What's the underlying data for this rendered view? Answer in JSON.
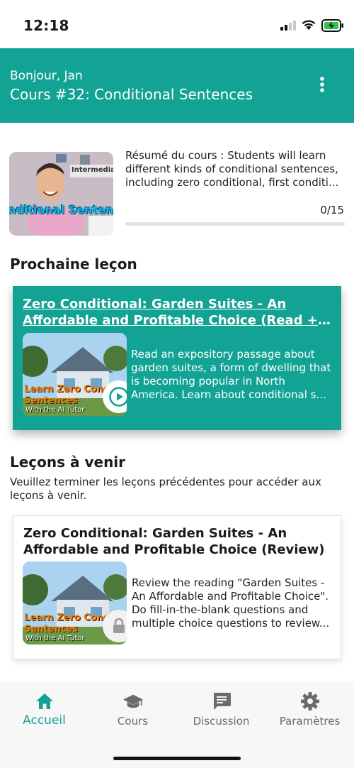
{
  "status_bar": {
    "time": "12:18"
  },
  "header": {
    "greeting": "Bonjour, Jan",
    "course_title": "Cours #32: Conditional Sentences"
  },
  "course": {
    "summary": "Résumé du cours : Students will learn different kinds of conditional sentences, including zero conditional, first conditi...",
    "progress_label": "0/15",
    "progress_value": 0,
    "thumbnail_text_top": "Intermediate C",
    "thumbnail_text_bottom": "nditional Sentenc"
  },
  "next_lesson": {
    "heading": "Prochaine leçon",
    "title_line1": "Zero Conditional: Garden Suites - An",
    "title_line2": "Affordable and Profitable Choice (Read + Sp...",
    "description": "Read an expository passage about garden suites, a form of dwelling that is becoming popular in North America. Learn about conditional s...",
    "thumb_line1": "Learn Zero Condi",
    "thumb_line2": "Sentences",
    "thumb_sub": "With the AI Tutor"
  },
  "upcoming": {
    "heading": "Leçons à venir",
    "note": "Veuillez terminer les leçons précédentes pour accéder aux leçons à venir.",
    "items": [
      {
        "title": "Zero Conditional: Garden Suites - An Affordable and Profitable Choice (Review)",
        "description": "Review the reading \"Garden Suites - An Affordable and Profitable Choice\". Do fill-in-the-blank questions and multiple choice questions to review...",
        "thumb_line1": "Learn Zero Condi",
        "thumb_line2": "Sentences",
        "thumb_sub": "With the AI Tutor"
      }
    ]
  },
  "bottom_nav": [
    {
      "label": "Accueil",
      "icon": "home-icon",
      "active": true
    },
    {
      "label": "Cours",
      "icon": "graduation-cap-icon",
      "active": false
    },
    {
      "label": "Discussion",
      "icon": "chat-icon",
      "active": false
    },
    {
      "label": "Paramètres",
      "icon": "gear-icon",
      "active": false
    }
  ],
  "colors": {
    "accent": "#12a394",
    "inactive": "#6b6b6b"
  }
}
